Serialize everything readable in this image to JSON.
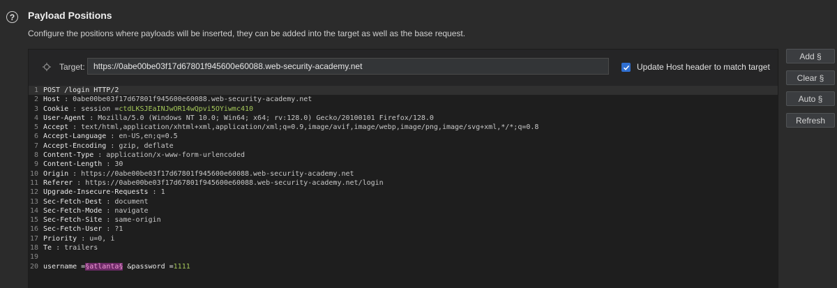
{
  "header": {
    "help_icon_glyph": "?",
    "title": "Payload Positions",
    "description": "Configure the positions where payloads will be inserted, they can be added into the target as well as the base request."
  },
  "target": {
    "label": "Target:",
    "url": "https://0abe00be03f17d67801f945600e60088.web-security-academy.net",
    "update_host_label": "Update Host header to match target",
    "update_host_checked": true
  },
  "buttons": {
    "add": "Add §",
    "clear": "Clear §",
    "auto": "Auto §",
    "refresh": "Refresh"
  },
  "request_lines": [
    {
      "n": "1",
      "parts": [
        [
          "k",
          "POST /login HTTP/2"
        ]
      ]
    },
    {
      "n": "2",
      "parts": [
        [
          "k",
          "Host"
        ],
        [
          "v",
          " : 0abe00be03f17d67801f945600e60088.web-security-academy.net"
        ]
      ]
    },
    {
      "n": "3",
      "parts": [
        [
          "k",
          "Cookie"
        ],
        [
          "v",
          " : session ="
        ],
        [
          "g",
          "ctdLKSJEaINJwOR14wQpvi5OYiwmc410"
        ]
      ]
    },
    {
      "n": "4",
      "parts": [
        [
          "k",
          "User-Agent"
        ],
        [
          "v",
          " : Mozilla/5.0 (Windows NT 10.0; Win64; x64; rv:128.0) Gecko/20100101 Firefox/128.0"
        ]
      ]
    },
    {
      "n": "5",
      "parts": [
        [
          "k",
          "Accept"
        ],
        [
          "v",
          " : text/html,application/xhtml+xml,application/xml;q=0.9,image/avif,image/webp,image/png,image/svg+xml,*/*;q=0.8"
        ]
      ]
    },
    {
      "n": "6",
      "parts": [
        [
          "k",
          "Accept-Language"
        ],
        [
          "v",
          " : en-US,en;q=0.5"
        ]
      ]
    },
    {
      "n": "7",
      "parts": [
        [
          "k",
          "Accept-Encoding"
        ],
        [
          "v",
          " : gzip, deflate"
        ]
      ]
    },
    {
      "n": "8",
      "parts": [
        [
          "k",
          "Content-Type"
        ],
        [
          "v",
          " : application/x-www-form-urlencoded"
        ]
      ]
    },
    {
      "n": "9",
      "parts": [
        [
          "k",
          "Content-Length"
        ],
        [
          "v",
          " : 30"
        ]
      ]
    },
    {
      "n": "10",
      "parts": [
        [
          "k",
          "Origin"
        ],
        [
          "v",
          " : https://0abe00be03f17d67801f945600e60088.web-security-academy.net"
        ]
      ]
    },
    {
      "n": "11",
      "parts": [
        [
          "k",
          "Referer"
        ],
        [
          "v",
          " : https://0abe00be03f17d67801f945600e60088.web-security-academy.net/login"
        ]
      ]
    },
    {
      "n": "12",
      "parts": [
        [
          "k",
          "Upgrade-Insecure-Requests"
        ],
        [
          "v",
          " : 1"
        ]
      ]
    },
    {
      "n": "13",
      "parts": [
        [
          "k",
          "Sec-Fetch-Dest"
        ],
        [
          "v",
          " : document"
        ]
      ]
    },
    {
      "n": "14",
      "parts": [
        [
          "k",
          "Sec-Fetch-Mode"
        ],
        [
          "v",
          " : navigate"
        ]
      ]
    },
    {
      "n": "15",
      "parts": [
        [
          "k",
          "Sec-Fetch-Site"
        ],
        [
          "v",
          " : same-origin"
        ]
      ]
    },
    {
      "n": "16",
      "parts": [
        [
          "k",
          "Sec-Fetch-User"
        ],
        [
          "v",
          " : ?1"
        ]
      ]
    },
    {
      "n": "17",
      "parts": [
        [
          "k",
          "Priority"
        ],
        [
          "v",
          " : u=0, i"
        ]
      ]
    },
    {
      "n": "18",
      "parts": [
        [
          "k",
          "Te"
        ],
        [
          "v",
          " : trailers"
        ]
      ]
    },
    {
      "n": "19",
      "parts": []
    },
    {
      "n": "20",
      "parts": [
        [
          "k",
          "username ="
        ],
        [
          "m",
          "§atlanta§"
        ],
        [
          "k",
          " &password ="
        ],
        [
          "g",
          "1111"
        ]
      ]
    }
  ],
  "colors": {
    "accent": "#2f6fd1",
    "payload_marker_bg": "#6c2a66",
    "value_green": "#a6c95a"
  }
}
